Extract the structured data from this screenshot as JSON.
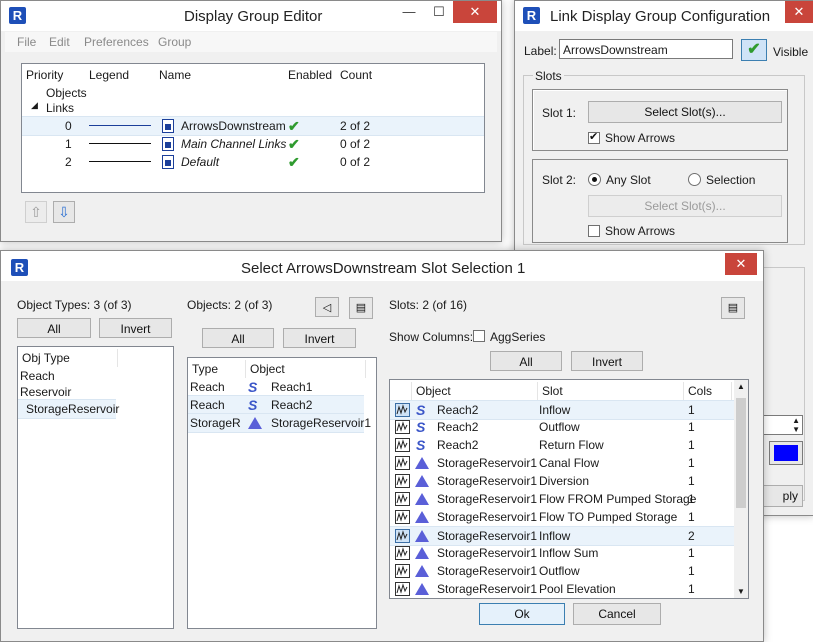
{
  "dge": {
    "title": "Display Group Editor",
    "menu": [
      "File",
      "Edit",
      "Preferences",
      "Group"
    ],
    "columns": [
      "Priority",
      "Legend",
      "Name",
      "Enabled",
      "Count"
    ],
    "tree": {
      "objects": "Objects",
      "links": "Links"
    },
    "rows": [
      {
        "priority": "0",
        "name": "ArrowsDownstream",
        "count": "2 of 2"
      },
      {
        "priority": "1",
        "name": "Main Channel Links",
        "count": "0 of 2"
      },
      {
        "priority": "2",
        "name": "Default",
        "count": "0 of 2"
      }
    ],
    "accent": "#1e4fb8"
  },
  "ldgc": {
    "title": "Link Display Group Configuration",
    "label_caption": "Label:",
    "label_value": "ArrowsDownstream",
    "visible_label": "Visible",
    "slots_caption": "Slots",
    "slot1_label": "Slot 1:",
    "slot1_button": "Select Slot(s)...",
    "slot1_show_arrows": "Show Arrows",
    "slot2_label": "Slot 2:",
    "slot2_any": "Any Slot",
    "slot2_selection": "Selection",
    "slot2_button": "Select Slot(s)...",
    "slot2_show_arrows": "Show Arrows",
    "apply_partial": "ply",
    "color_swatch": "#0000ff"
  },
  "sel": {
    "title": "Select ArrowsDownstream Slot Selection 1",
    "object_types_caption": "Object Types: 3 (of 3)",
    "objects_caption": "Objects: 2 (of 3)",
    "slots_caption": "Slots: 2 (of 16)",
    "all": "All",
    "invert": "Invert",
    "show_columns": "Show Columns:",
    "aggseries": "AggSeries",
    "obj_type_header": "Obj Type",
    "obj_types": [
      "Reach",
      "Reservoir",
      "StorageReservoir"
    ],
    "objects_headers": [
      "Type",
      "Object"
    ],
    "objects": [
      {
        "type": "Reach",
        "object": "Reach1"
      },
      {
        "type": "Reach",
        "object": "Reach2"
      },
      {
        "type": "StorageR",
        "object": "StorageReservoir1"
      }
    ],
    "slots_headers": [
      "Object",
      "Slot",
      "Cols"
    ],
    "slots": [
      {
        "object": "Reach2",
        "slot": "Inflow",
        "cols": "1"
      },
      {
        "object": "Reach2",
        "slot": "Outflow",
        "cols": "1"
      },
      {
        "object": "Reach2",
        "slot": "Return Flow",
        "cols": "1"
      },
      {
        "object": "StorageReservoir1",
        "slot": "Canal Flow",
        "cols": "1"
      },
      {
        "object": "StorageReservoir1",
        "slot": "Diversion",
        "cols": "1"
      },
      {
        "object": "StorageReservoir1",
        "slot": "Flow FROM Pumped Storage",
        "cols": "1"
      },
      {
        "object": "StorageReservoir1",
        "slot": "Flow TO Pumped Storage",
        "cols": "1"
      },
      {
        "object": "StorageReservoir1",
        "slot": "Inflow",
        "cols": "2"
      },
      {
        "object": "StorageReservoir1",
        "slot": "Inflow Sum",
        "cols": "1"
      },
      {
        "object": "StorageReservoir1",
        "slot": "Outflow",
        "cols": "1"
      },
      {
        "object": "StorageReservoir1",
        "slot": "Pool Elevation",
        "cols": "1"
      }
    ],
    "ok": "Ok",
    "cancel": "Cancel"
  }
}
